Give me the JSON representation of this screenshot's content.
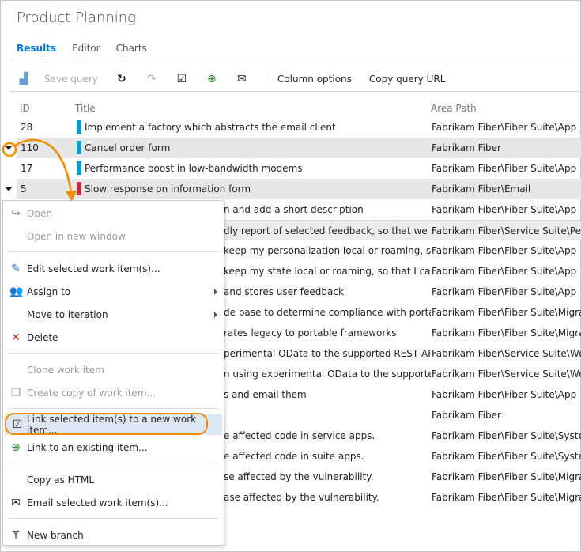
{
  "header": {
    "title": "Product Planning"
  },
  "tabs": [
    {
      "label": "Results"
    },
    {
      "label": "Editor"
    },
    {
      "label": "Charts"
    }
  ],
  "toolbar": {
    "save_query": "Save query",
    "column_options": "Column options",
    "copy_query_url": "Copy query URL"
  },
  "columns": {
    "id": "ID",
    "title": "Title",
    "area": "Area Path"
  },
  "rows": [
    {
      "id": "28",
      "title": "Implement a factory which abstracts the email client",
      "area": "Fabrikam Fiber\\Fiber Suite\\App",
      "color": "#009ccc"
    },
    {
      "id": "110",
      "title": "Cancel order form",
      "area": "Fabrikam Fiber",
      "color": "#009ccc"
    },
    {
      "id": "17",
      "title": "Performance boost in low-bandwidth modems",
      "area": "Fabrikam Fiber\\Fiber Suite\\App",
      "color": "#009ccc"
    },
    {
      "id": "5",
      "title": "Slow response on information form",
      "area": "Fabrikam Fiber\\Email",
      "color": "#cc293d"
    },
    {
      "title": "n and add a short description",
      "area": "Fabrikam Fiber\\Fiber Suite\\App"
    },
    {
      "title": "dly report of selected feedback, so that we can...",
      "area": "Fabrikam Fiber\\Service Suite\\Perfor"
    },
    {
      "title": "keep my personalization local or roaming, so t...",
      "area": "Fabrikam Fiber\\Fiber Suite\\App"
    },
    {
      "title": "keep my state local or roaming, so that I can s...",
      "area": "Fabrikam Fiber\\Fiber Suite\\App"
    },
    {
      "title": "and stores user feedback",
      "area": "Fabrikam Fiber\\Fiber Suite\\App"
    },
    {
      "title": "de base to determine compliance with portabl...",
      "area": "Fabrikam Fiber\\Fiber Suite\\Migrate"
    },
    {
      "title": "rates legacy to portable frameworks",
      "area": "Fabrikam Fiber\\Fiber Suite\\Migrate"
    },
    {
      "title": "perimental OData to the supported REST API",
      "area": "Fabrikam Fiber\\Service Suite\\Web S"
    },
    {
      "title": "n using experimental OData to the supported...",
      "area": "Fabrikam Fiber\\Service Suite\\Web S"
    },
    {
      "title": "s and email them",
      "area": "Fabrikam Fiber\\Fiber Suite\\App"
    },
    {
      "title": "",
      "area": "Fabrikam Fiber"
    },
    {
      "title": "e affected code in service apps.",
      "area": "Fabrikam Fiber\\Fiber Suite\\System"
    },
    {
      "title": "e affected code in suite apps.",
      "area": "Fabrikam Fiber\\Fiber Suite\\System"
    },
    {
      "title": "se affected by the vulnerability.",
      "area": "Fabrikam Fiber\\Fiber Suite\\Migrate"
    },
    {
      "title": "ase affected by the vulnerability.",
      "area": "Fabrikam Fiber\\Fiber Suite\\Migrate"
    }
  ],
  "menu": {
    "open": "Open",
    "open_new": "Open in new window",
    "edit": "Edit selected work item(s)...",
    "assign": "Assign to",
    "move": "Move to iteration",
    "delete": "Delete",
    "clone": "Clone work item",
    "copy": "Create copy of work item...",
    "link_new": "Link selected item(s) to a new work item...",
    "link_existing": "Link to an existing item...",
    "copy_html": "Copy as HTML",
    "email": "Email selected work item(s)...",
    "new_branch": "New branch"
  },
  "colors": {
    "accent": "#0078d7",
    "highlight": "#f08c00"
  }
}
